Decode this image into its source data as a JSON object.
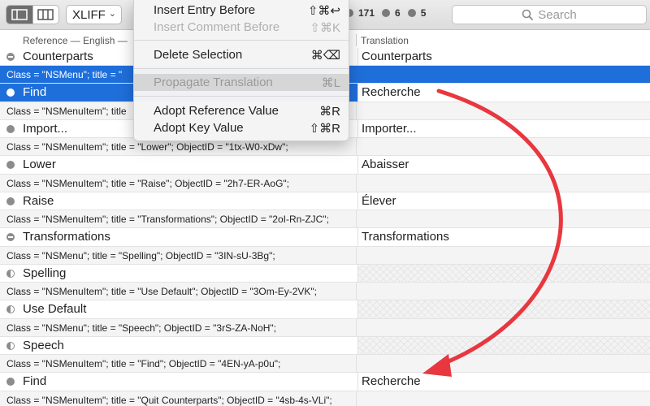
{
  "toolbar": {
    "format": "XLIFF",
    "counts": [
      "171",
      "6",
      "5"
    ],
    "search_placeholder": "Search"
  },
  "columns": {
    "reference": "Reference — English —",
    "translation": "Translation"
  },
  "menu": {
    "items": [
      {
        "label": "Insert Entry Before",
        "shortcut": "⇧⌘↩"
      },
      {
        "label": "Insert Comment Before",
        "shortcut": "⇧⌘K"
      },
      {
        "label": "Delete Selection",
        "shortcut": "⌘⌫"
      },
      {
        "label": "Propagate Translation",
        "shortcut": "⌘L"
      },
      {
        "label": "Adopt Reference Value",
        "shortcut": "⌘R"
      },
      {
        "label": "Adopt Key Value",
        "shortcut": "⇧⌘R"
      }
    ]
  },
  "rows": [
    {
      "ref": "Counterparts",
      "trans": "Counterparts"
    },
    {
      "cls": "Class = \"NSMenu\"; title = \""
    },
    {
      "ref": "Find",
      "trans": "Recherche"
    },
    {
      "cls": "Class = \"NSMenuItem\"; title"
    },
    {
      "ref": "Import...",
      "trans": "Importer..."
    },
    {
      "cls": "Class = \"NSMenuItem\"; title = \"Lower\"; ObjectID = \"1tx-W0-xDw\";"
    },
    {
      "ref": "Lower",
      "trans": "Abaisser"
    },
    {
      "cls": "Class = \"NSMenuItem\"; title = \"Raise\"; ObjectID = \"2h7-ER-AoG\";"
    },
    {
      "ref": "Raise",
      "trans": "Élever"
    },
    {
      "cls": "Class = \"NSMenuItem\"; title = \"Transformations\"; ObjectID = \"2oI-Rn-ZJC\";"
    },
    {
      "ref": "Transformations",
      "trans": "Transformations"
    },
    {
      "cls": "Class = \"NSMenu\"; title = \"Spelling\"; ObjectID = \"3IN-sU-3Bg\";"
    },
    {
      "ref": "Spelling",
      "trans": ""
    },
    {
      "cls": "Class = \"NSMenuItem\"; title = \"Use Default\"; ObjectID = \"3Om-Ey-2VK\";"
    },
    {
      "ref": "Use Default",
      "trans": ""
    },
    {
      "cls": "Class = \"NSMenu\"; title = \"Speech\"; ObjectID = \"3rS-ZA-NoH\";"
    },
    {
      "ref": "Speech",
      "trans": ""
    },
    {
      "cls": "Class = \"NSMenuItem\"; title = \"Find\"; ObjectID = \"4EN-yA-p0u\";"
    },
    {
      "ref": "Find",
      "trans": "Recherche"
    },
    {
      "cls": "Class = \"NSMenuItem\"; title = \"Quit Counterparts\"; ObjectID = \"4sb-4s-VLi\";"
    }
  ],
  "colors": {
    "selection": "#1f6fdb",
    "arrow": "#e8373f"
  }
}
